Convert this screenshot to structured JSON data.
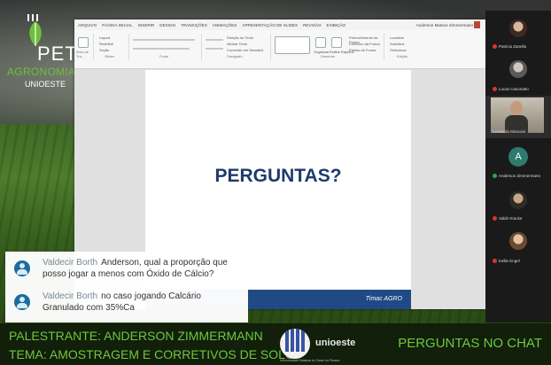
{
  "logo": {
    "pet": "PET",
    "agronomia": "AGRONOMIA",
    "unioeste": "UNIOESTE"
  },
  "ppt": {
    "tabs": [
      "ARQUIVO",
      "PÁGINA INICIAL",
      "INSERIR",
      "DESIGN",
      "TRANSIÇÕES",
      "ANIMAÇÕES",
      "APRESENTAÇÃO DE SLIDES",
      "REVISÃO",
      "EXIBIÇÃO"
    ],
    "user": "Anderson Mateus Zimmermann",
    "groups": [
      "Área de Tra...",
      "Slides",
      "Fonte",
      "Parágrafo",
      "Desenho",
      "Edição"
    ],
    "ribbon_items": {
      "layout": "Layout",
      "redefinir": "Redefinir",
      "secao": "Seção",
      "direcao": "Direção do Texto",
      "alinhar": "Alinhar Texto",
      "converter": "Converter em SmartArt",
      "organizar": "Organizar",
      "estilos": "Estilos Rápidos",
      "preenchimento": "Preenchimento da Forma",
      "contorno": "Contorno da Forma",
      "efeitos": "Efeitos de Forma",
      "localizar": "Localizar",
      "substituir": "Substituir",
      "selecionar": "Selecionar"
    },
    "slide_title": "PERGUNTAS?",
    "slide_brand": "Timac AGRO"
  },
  "chat": [
    {
      "name": "Valdecir Borth",
      "text": "Anderson, qual a proporção que posso jogar a menos com Óxido de Cálcio?"
    },
    {
      "name": "Valdecir Borth",
      "text": "no caso jogando Calcário Granulado com 35%Ca"
    }
  ],
  "participants": [
    {
      "name": "Patricia Zanella",
      "muted": true
    },
    {
      "name": "Lucas Casonatto",
      "muted": true
    },
    {
      "name": "Leonardo Mosconi",
      "muted": false
    },
    {
      "name": "Anderson Zimmermann",
      "muted": false,
      "letter": "A"
    },
    {
      "name": "Valdir Kracke",
      "muted": true
    },
    {
      "name": "Kellie Engel",
      "muted": true
    }
  ],
  "banner": {
    "line1": "PALESTRANTE: ANDERSON ZIMMERMANN",
    "line2": "TEMA:  AMOSTRAGEM E CORRETIVOS DE SOLO",
    "right": "PERGUNTAS NO CHAT",
    "uni_name": "unioeste",
    "uni_sub": "Universidade Estadual do Oeste do Paraná"
  }
}
